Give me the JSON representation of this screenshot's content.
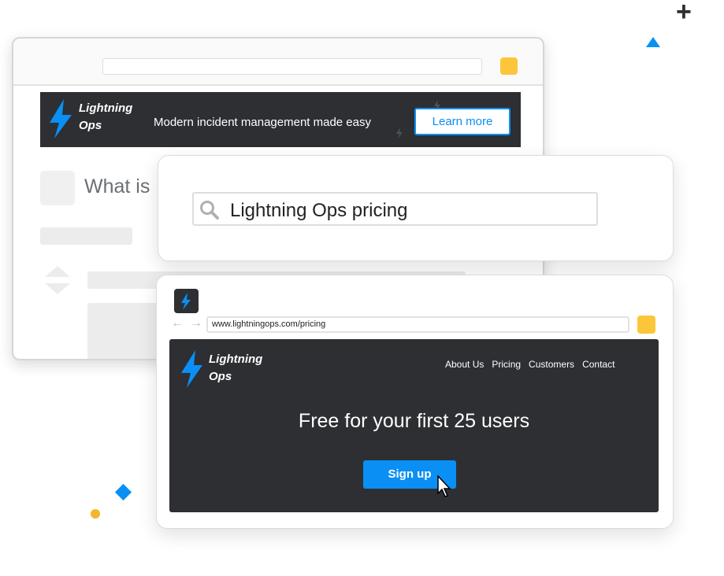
{
  "colors": {
    "accent": "#0a8ff5",
    "dark": "#2d2f33",
    "yellow": "#fcc63a"
  },
  "back_window": {
    "banner": {
      "brand_line1": "Lightning",
      "brand_line2": "Ops",
      "tagline": "Modern incident management made easy",
      "cta": "Learn more"
    },
    "heading": "What is"
  },
  "search": {
    "query": "Lightning Ops pricing",
    "icon": "search-icon"
  },
  "front_window": {
    "url": "www.lightningops.com/pricing",
    "brand_line1": "Lightning",
    "brand_line2": "Ops",
    "nav": [
      "About Us",
      "Pricing",
      "Customers",
      "Contact"
    ],
    "headline": "Free for your first 25 users",
    "cta": "Sign up"
  }
}
